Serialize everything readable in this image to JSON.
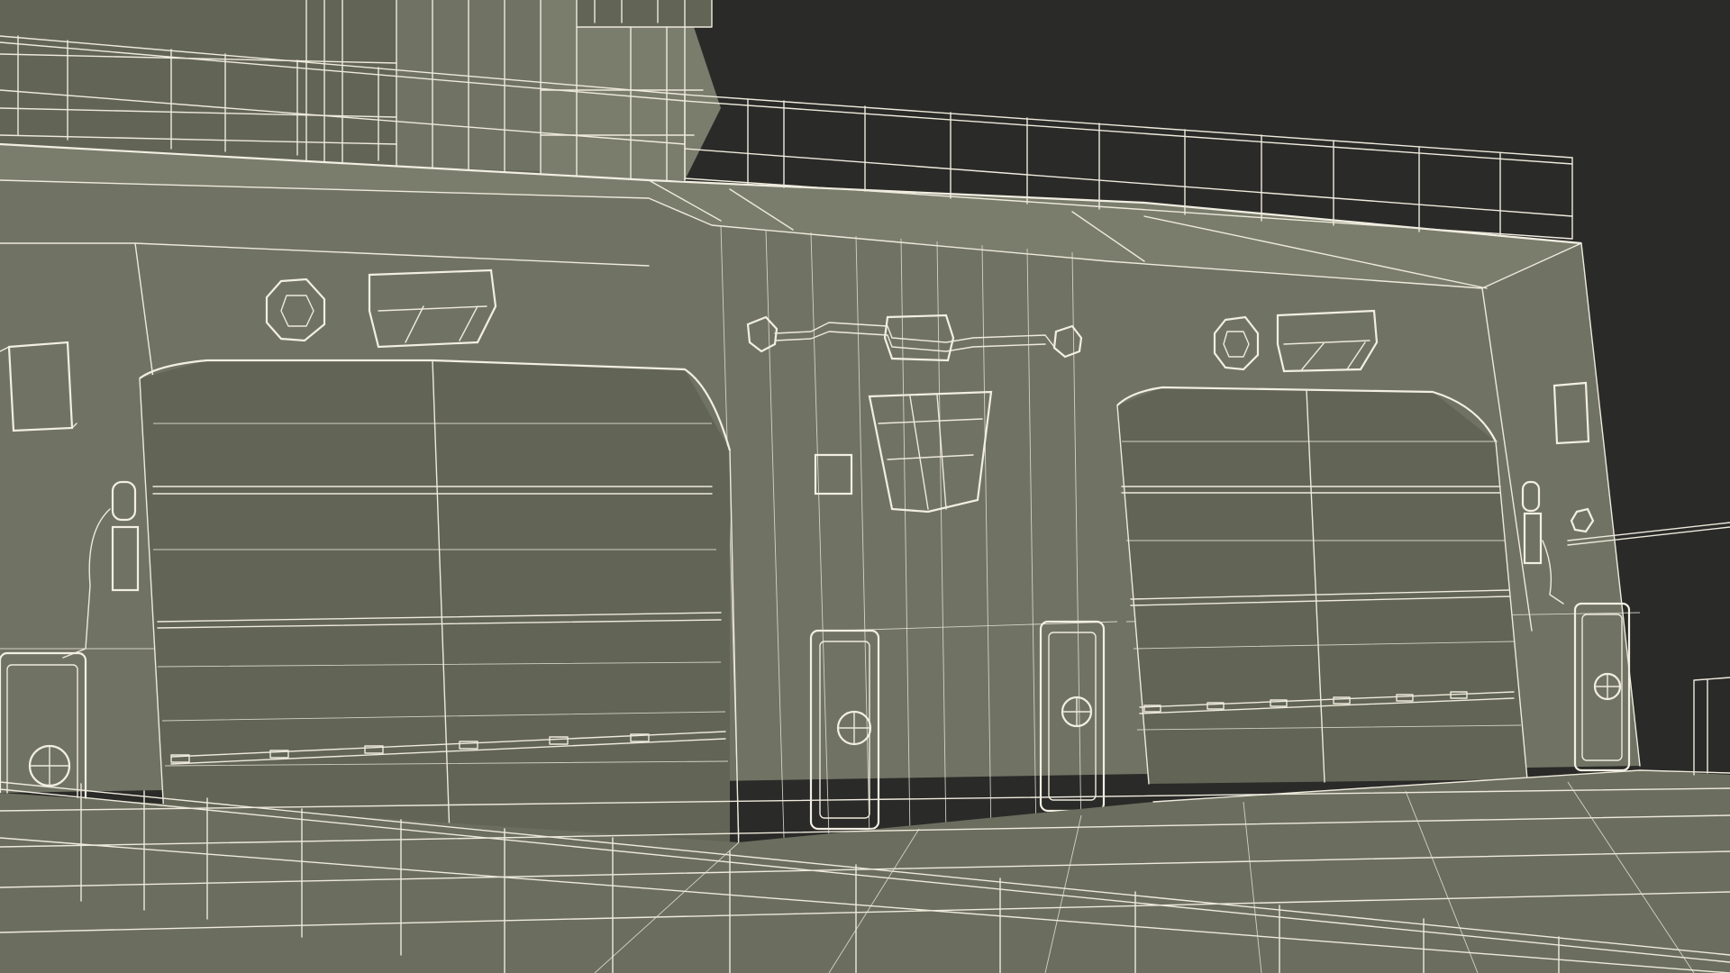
{
  "scene": {
    "background": "#2a2a29",
    "hull_color": "#707363",
    "hull_dark": "#626555",
    "deck_color": "#6b6e5e",
    "wire_color": "#eeeadc",
    "icons": [
      "ship-superstructure",
      "hangar-door",
      "watertight-door",
      "porthole",
      "vent",
      "lamp",
      "railing"
    ]
  }
}
